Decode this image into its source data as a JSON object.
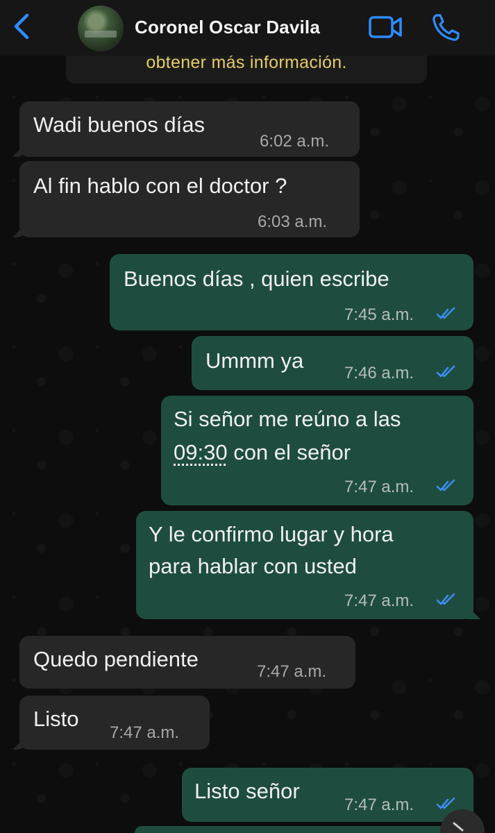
{
  "header": {
    "contact_name": "Coronel Oscar Davila",
    "back_icon": "chevron-left-icon",
    "video_icon": "video-camera-icon",
    "call_icon": "phone-icon",
    "accent": "#2f8cff"
  },
  "notice": {
    "text": "obtener más información."
  },
  "messages": [
    {
      "dir": "in",
      "lines": [
        "Wadi buenos días"
      ],
      "time": "6:02 a.m."
    },
    {
      "dir": "in",
      "lines": [
        "Al fin hablo con el doctor ?"
      ],
      "time": "6:03 a.m."
    },
    {
      "dir": "out",
      "lines": [
        "Buenos días , quien escribe"
      ],
      "time": "7:45 a.m."
    },
    {
      "dir": "out",
      "lines": [
        "Ummm ya"
      ],
      "time": "7:46 a.m."
    },
    {
      "dir": "out",
      "lines": [
        "Si señor me reúno a las",
        "09:30",
        " con el señor"
      ],
      "time": "7:47 a.m."
    },
    {
      "dir": "out",
      "lines": [
        "Y le confirmo lugar y hora",
        "para hablar con usted"
      ],
      "time": "7:47 a.m."
    },
    {
      "dir": "in",
      "lines": [
        "Quedo pendiente"
      ],
      "time": "7:47 a.m."
    },
    {
      "dir": "in",
      "lines": [
        "Listo"
      ],
      "time": "7:47 a.m."
    },
    {
      "dir": "out",
      "lines": [
        "Listo señor"
      ],
      "time": "7:47 a.m."
    }
  ],
  "colors": {
    "incoming_bubble": "#272727",
    "outgoing_bubble": "#1e4d3f",
    "read_ticks": "#3d8ef0",
    "notice_text": "#e5cc68"
  },
  "scroll_icon": "chevron-down-icon"
}
